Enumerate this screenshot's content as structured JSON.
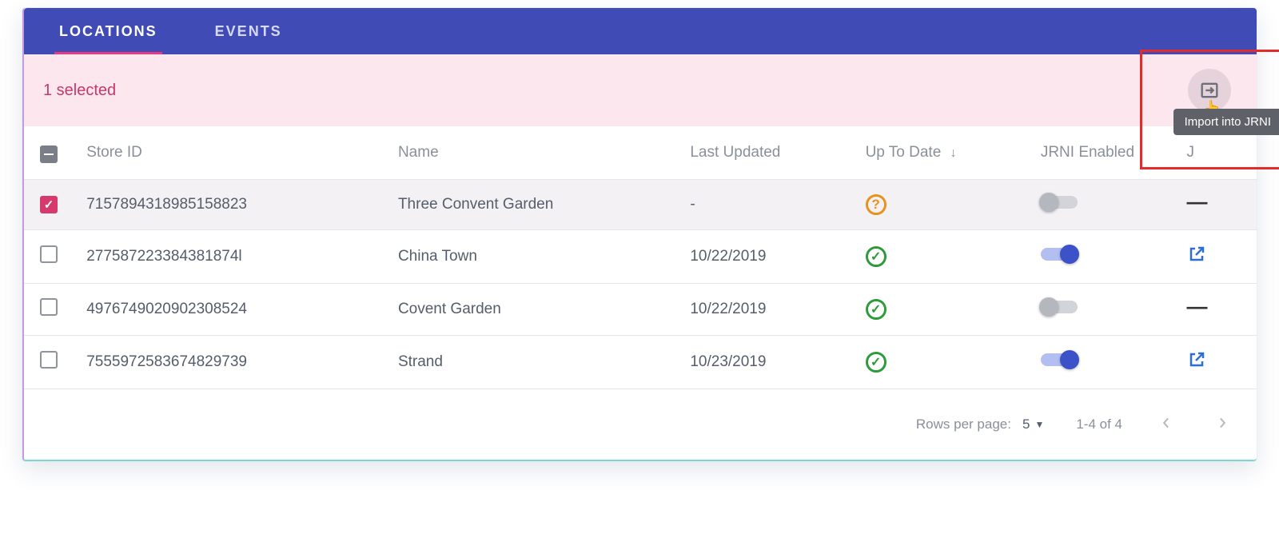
{
  "tabs": {
    "items": [
      {
        "label": "LOCATIONS",
        "active": true
      },
      {
        "label": "EVENTS",
        "active": false
      }
    ]
  },
  "selection_bar": {
    "text": "1 selected",
    "tooltip": "Import into JRNI"
  },
  "table": {
    "headers": {
      "store_id": "Store ID",
      "name": "Name",
      "last_updated": "Last Updated",
      "up_to_date": "Up To Date",
      "jrni_enabled": "JRNI Enabled",
      "j": "J"
    },
    "sort_indicator": "↓",
    "rows": [
      {
        "selected": true,
        "store_id": "7157894318985158823",
        "name": "Three Convent Garden",
        "last_updated": "-",
        "up_to_date": "question",
        "jrni_enabled": false,
        "link": "dash"
      },
      {
        "selected": false,
        "store_id": "277587223384381874l",
        "name": "China Town",
        "last_updated": "10/22/2019",
        "up_to_date": "ok",
        "jrni_enabled": true,
        "link": "open"
      },
      {
        "selected": false,
        "store_id": "4976749020902308524",
        "name": "Covent Garden",
        "last_updated": "10/22/2019",
        "up_to_date": "ok",
        "jrni_enabled": false,
        "link": "dash"
      },
      {
        "selected": false,
        "store_id": "7555972583674829739",
        "name": "Strand",
        "last_updated": "10/23/2019",
        "up_to_date": "ok",
        "jrni_enabled": true,
        "link": "open"
      }
    ]
  },
  "footer": {
    "rows_per_page_label": "Rows per page:",
    "rows_per_page_value": "5",
    "range": "1-4 of 4"
  }
}
